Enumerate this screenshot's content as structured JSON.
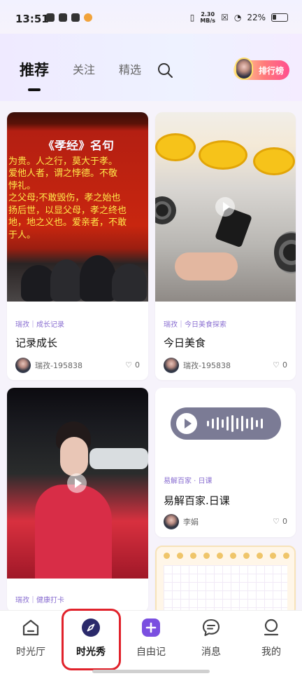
{
  "status": {
    "time": "13:51",
    "net_speed_value": "2.30",
    "net_speed_unit": "MB/s",
    "battery": "22%"
  },
  "tabs": [
    {
      "label": "推荐",
      "active": true
    },
    {
      "label": "关注",
      "active": false
    },
    {
      "label": "精选",
      "active": false
    }
  ],
  "rank_label": "排行榜",
  "posts": [
    {
      "tags": "瑞孜｜成长记录",
      "title": "记录成长",
      "author": "瑞孜-195838",
      "likes": "0",
      "image_text": {
        "title": "《孝经》名句",
        "lines": [
          "为贵。人之行，莫大于孝。",
          "爱他人者，谓之悖德。不敬",
          "悖礼。",
          "之父母;不敢毁伤，孝之始也",
          "扬后世，以显父母，孝之终也",
          "地，地之义也。爱亲者，不敢",
          "于人。"
        ]
      }
    },
    {
      "tags": "瑞孜｜今日美食探索",
      "title": "今日美食",
      "author": "瑞孜-195838",
      "likes": "0"
    },
    {
      "tags": "瑞孜｜健康打卡"
    },
    {
      "tags": "易解百家 · 日课",
      "title": "易解百家.日课",
      "author": "李娟",
      "likes": "0"
    }
  ],
  "nav": [
    {
      "label": "时光厅",
      "icon": "home-icon"
    },
    {
      "label": "时光秀",
      "icon": "compass-icon",
      "active": true
    },
    {
      "label": "自由记",
      "icon": "plus-icon"
    },
    {
      "label": "消息",
      "icon": "chat-icon"
    },
    {
      "label": "我的",
      "icon": "profile-icon"
    }
  ],
  "colors": {
    "accent": "#7a4fe0",
    "tag": "#8a6fd1",
    "highlight_ring": "#e1222b"
  }
}
